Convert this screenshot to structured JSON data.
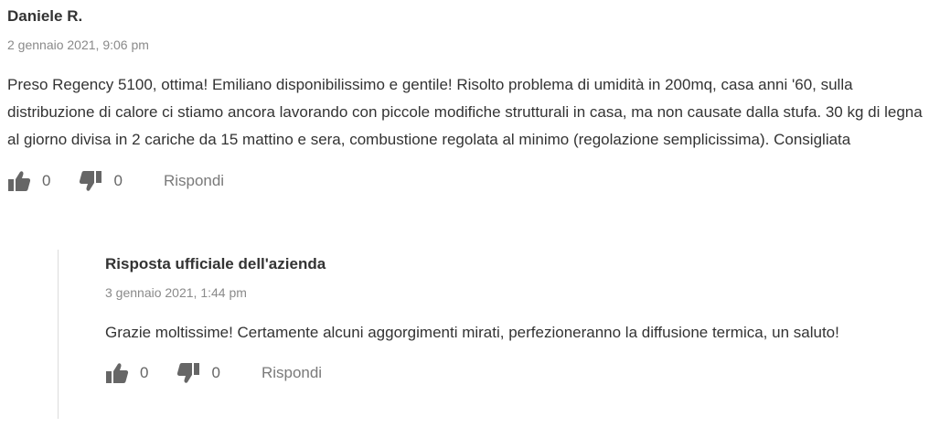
{
  "review": {
    "author": "Daniele R.",
    "date": "2 gennaio 2021, 9:06 pm",
    "text": "Preso Regency 5100, ottima! Emiliano disponibilissimo e gentile! Risolto problema di umidità in 200mq, casa anni '60, sulla distribuzione di calore ci stiamo ancora lavorando con piccole modifiche strutturali in casa, ma non causate dalla stufa. 30 kg di legna al giorno divisa in 2 cariche da 15 mattino e sera, combustione regolata al minimo (regolazione semplicissima). Consigliata",
    "likes": "0",
    "dislikes": "0",
    "reply_label": "Rispondi"
  },
  "response": {
    "author": "Risposta ufficiale dell'azienda",
    "date": "3 gennaio 2021, 1:44 pm",
    "text": "Grazie moltissime! Certamente alcuni aggorgimenti mirati, perfezioneranno la diffusione termica, un saluto!",
    "likes": "0",
    "dislikes": "0",
    "reply_label": "Rispondi"
  },
  "icons": {
    "like": "thumbs-up-icon",
    "dislike": "thumbs-down-icon",
    "color": "#666666"
  }
}
